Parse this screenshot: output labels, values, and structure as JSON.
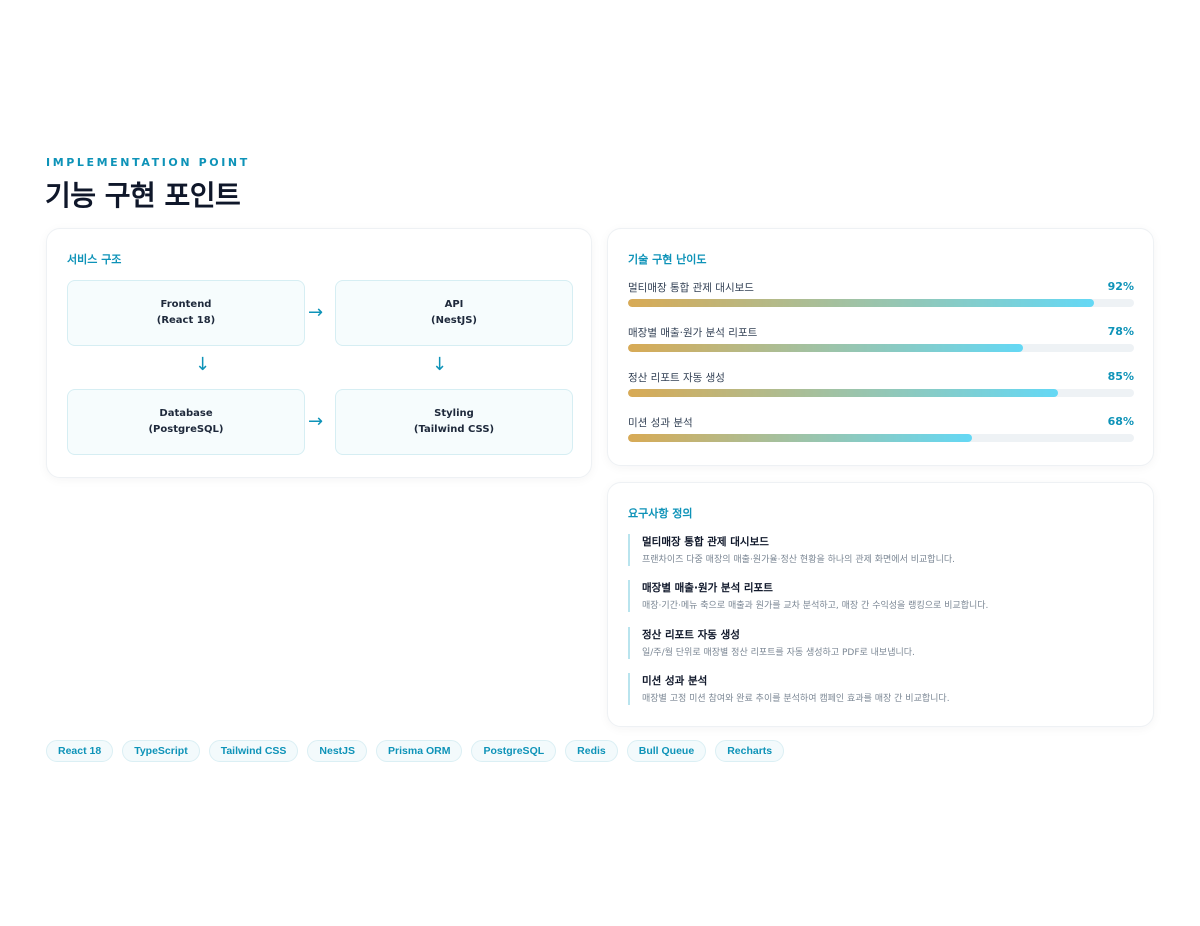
{
  "header": {
    "eyebrow": "IMPLEMENTATION POINT",
    "title": "기능 구현 포인트"
  },
  "architecture": {
    "title": "서비스 구조",
    "nodes": [
      {
        "name": "Frontend",
        "detail": "(React 18)"
      },
      {
        "name": "API",
        "detail": "(NestJS)"
      },
      {
        "name": "Database",
        "detail": "(PostgreSQL)"
      },
      {
        "name": "Styling",
        "detail": "(Tailwind CSS)"
      }
    ],
    "arrows": {
      "right": "→",
      "down": "↓"
    }
  },
  "difficulty": {
    "title": "기술 구현 난이도",
    "items": [
      {
        "label": "멀티매장 통합 관제 대시보드",
        "percent_label": "92%",
        "value": 92
      },
      {
        "label": "매장별 매출·원가 분석 리포트",
        "percent_label": "78%",
        "value": 78
      },
      {
        "label": "정산 리포트 자동 생성",
        "percent_label": "85%",
        "value": 85
      },
      {
        "label": "미션 성과 분석",
        "percent_label": "68%",
        "value": 68
      }
    ]
  },
  "requirements": {
    "title": "요구사항 정의",
    "items": [
      {
        "title": "멀티매장 통합 관제 대시보드",
        "desc": "프랜차이즈 다중 매장의 매출·원가율·정산 현황을 하나의 관제 화면에서 비교합니다."
      },
      {
        "title": "매장별 매출·원가 분석 리포트",
        "desc": "매장·기간·메뉴 축으로 매출과 원가를 교차 분석하고, 매장 간 수익성을 랭킹으로 비교합니다."
      },
      {
        "title": "정산 리포트 자동 생성",
        "desc": "일/주/월 단위로 매장별 정산 리포트를 자동 생성하고 PDF로 내보냅니다."
      },
      {
        "title": "미션 성과 분석",
        "desc": "매장별 고정 미션 참여와 완료 추이를 분석하여 캠페인 효과를 매장 간 비교합니다."
      }
    ]
  },
  "tech_stack": [
    "React 18",
    "TypeScript",
    "Tailwind CSS",
    "NestJS",
    "Prisma ORM",
    "PostgreSQL",
    "Redis",
    "Bull Queue",
    "Recharts"
  ],
  "colors": {
    "accent": "#0e93b8",
    "bar_gradient": [
      "#d8aa55",
      "#9ec3a7",
      "#64d8f5"
    ],
    "track": "#eef2f5"
  }
}
